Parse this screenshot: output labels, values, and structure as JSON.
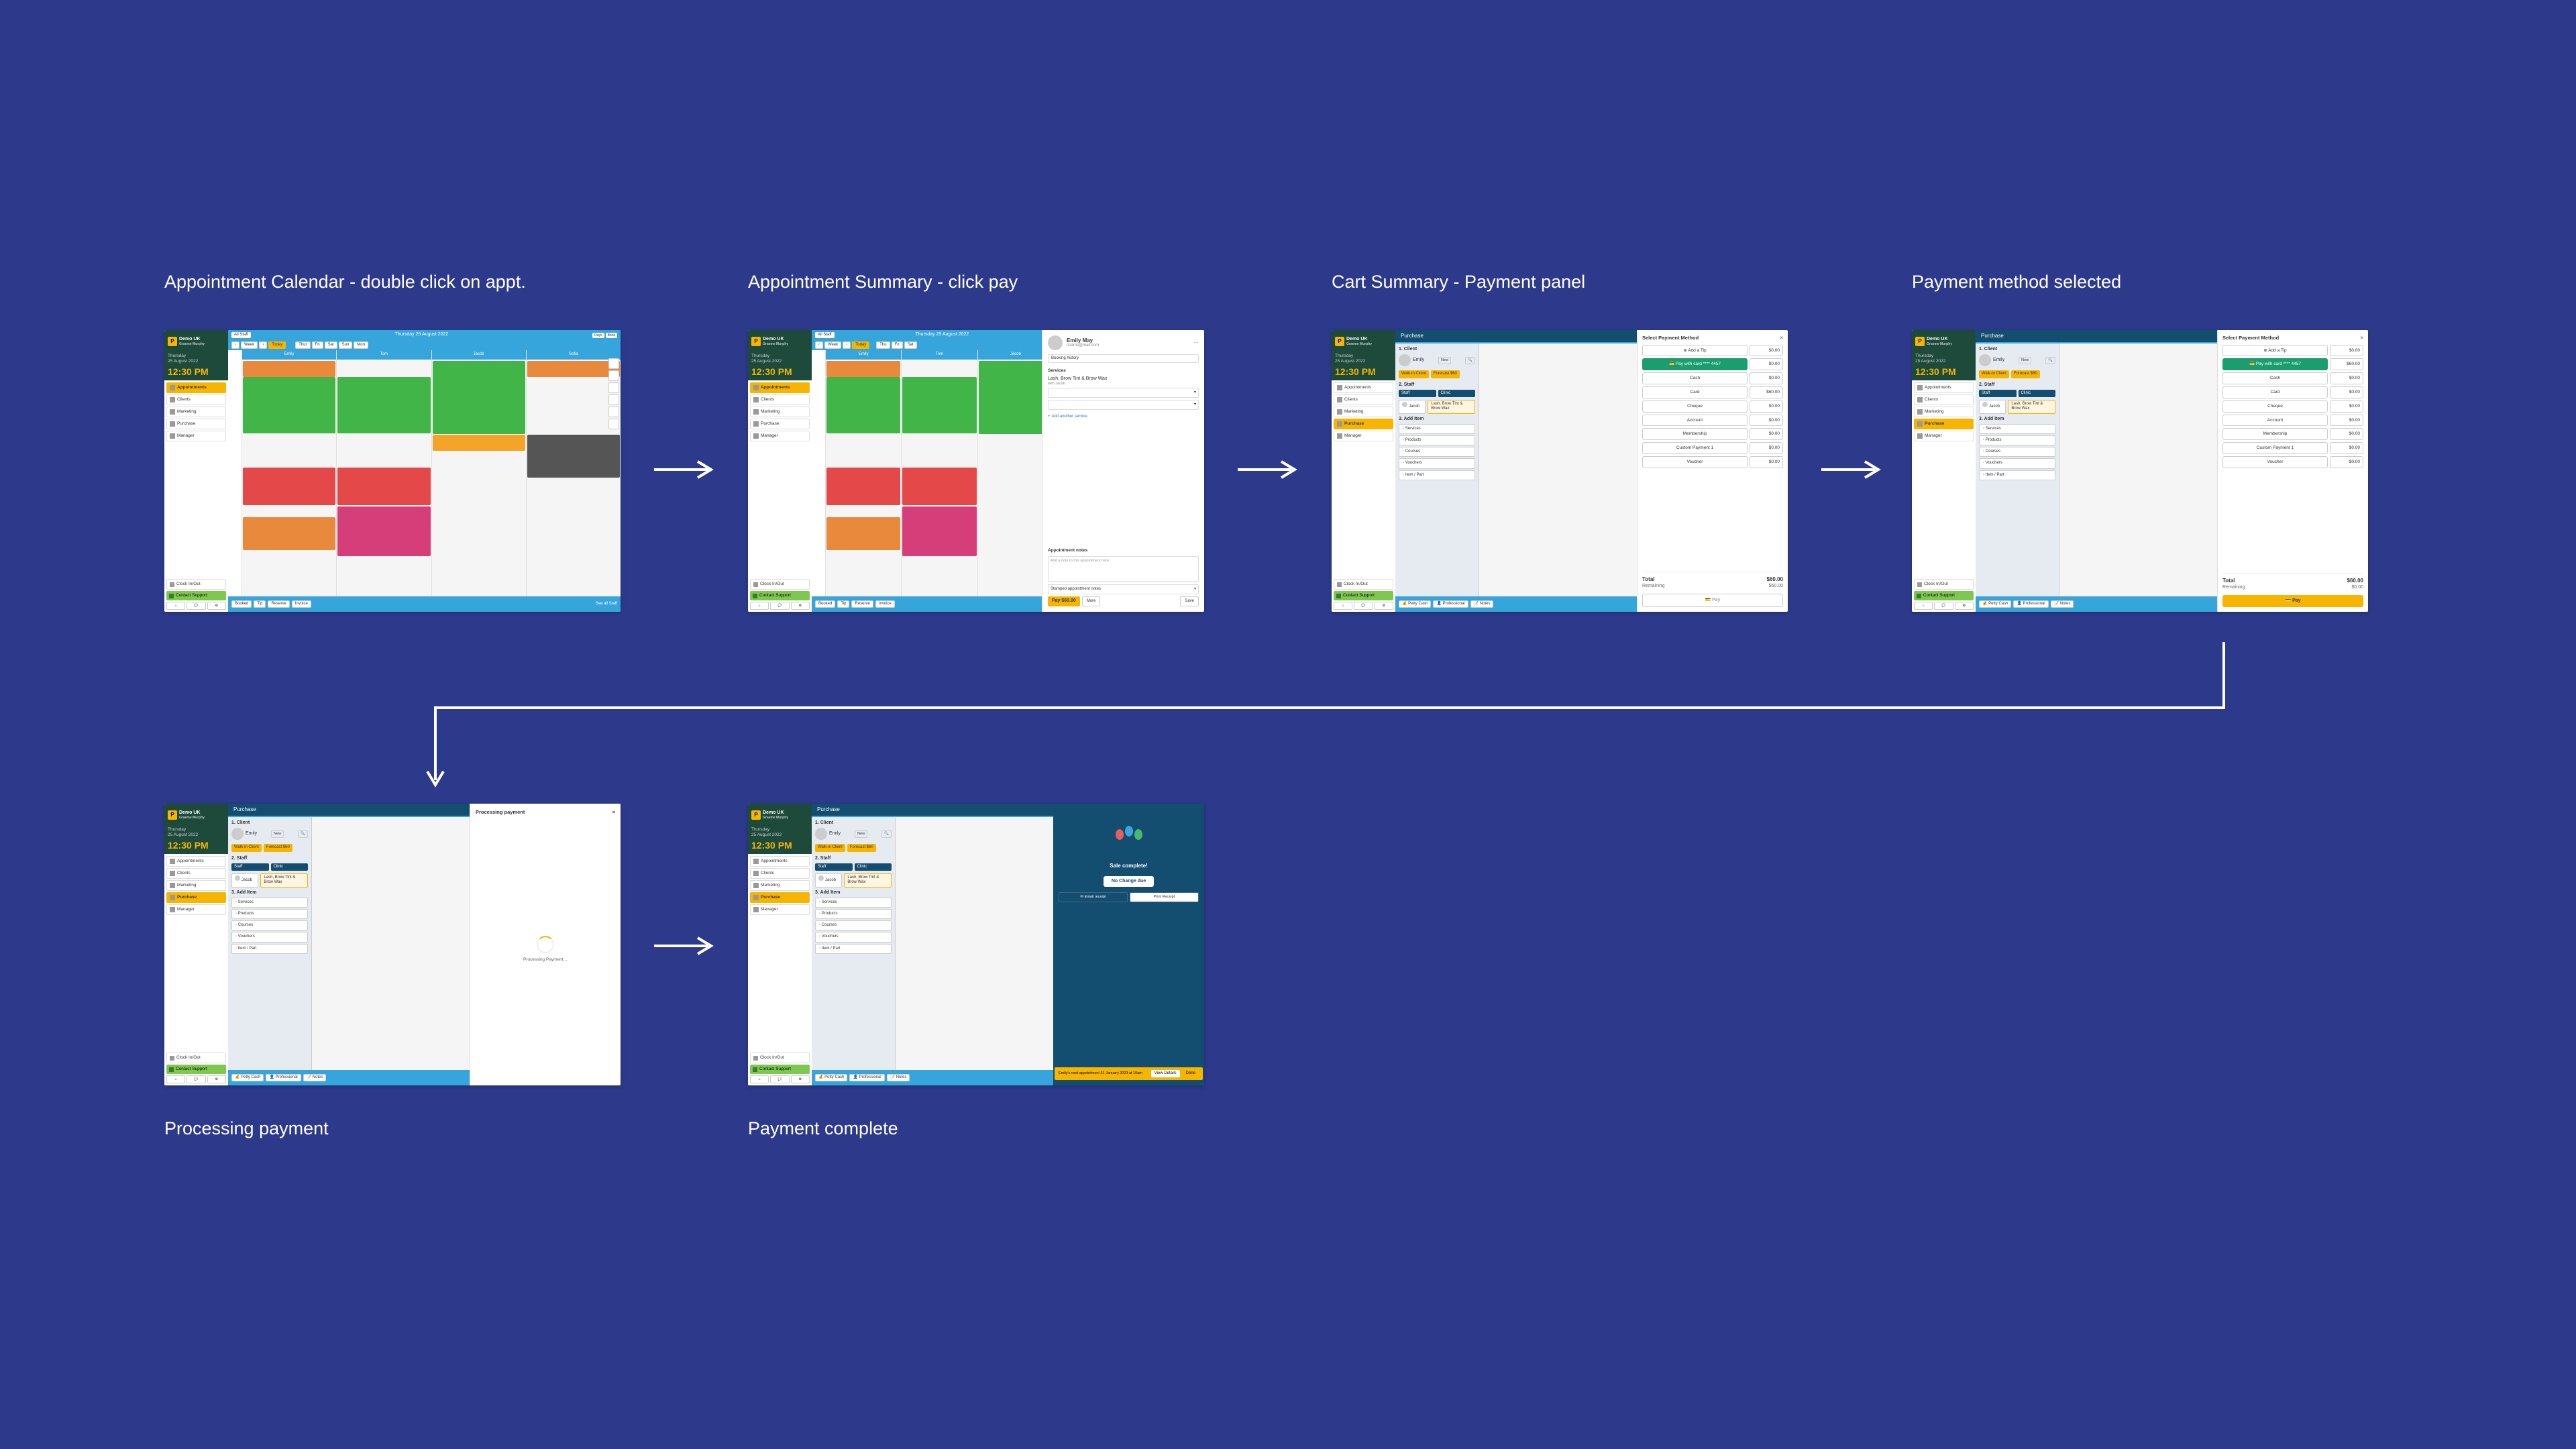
{
  "labels": {
    "s1": "Appointment Calendar - double click on appt.",
    "s2": "Appointment Summary - click pay",
    "s3": "Cart Summary - Payment panel",
    "s4": "Payment method selected",
    "s5": "Processing payment",
    "s6": "Payment complete"
  },
  "sidebar": {
    "brand": "Demo UK",
    "brand_sub": "Graeme Murphy",
    "date_label": "Thursday",
    "date_sub": "25 August 2022",
    "time": "12:30 PM",
    "nav": {
      "appts": "Appointments",
      "clients": "Clients",
      "marketing": "Marketing",
      "purchase": "Purchase",
      "manager": "Manager"
    },
    "clock": "Clock In/Out",
    "support": "Contact Support"
  },
  "calendar": {
    "staffbtn": "All Staff",
    "date": "Thursday 25 August 2022",
    "view_days": "Days",
    "view_book": "Book",
    "nav_week": "Week",
    "nav_today": "Today",
    "col1": "Emily",
    "col2": "Tom",
    "col3": "Jacob",
    "col4": "Sofia",
    "bottom_tags": [
      "Booked",
      "Tip",
      "Reserve",
      "Invoice"
    ],
    "see_all": "See all Staff"
  },
  "appt_panel": {
    "name": "Emily May",
    "email": "charris@mail.com",
    "booking_history": "Booking history",
    "services_hdr": "Services",
    "svc": "Lash, Brow Tint & Brow Wax",
    "svc_sub": "with Jacob",
    "select_placeholder": "",
    "add_another": "Add another service",
    "notes_hdr": "Appointment notes",
    "notes_placeholder": "Add a note to this appointment here",
    "stamp": "Stamped appointment notes",
    "pay_btn": "Pay $60.00",
    "more": "More",
    "save": "Save"
  },
  "purchase": {
    "title": "Purchase",
    "client_hdr": "1. Client",
    "client_name": "Emily",
    "new": "New",
    "q_search": "Q",
    "walkin": "Walk-in Client",
    "forecast": "Forecast $60",
    "staff_hdr": "2. Staff",
    "staff_col1": "Staff",
    "staff_col2": "Clinic",
    "staff_sel": "Jacob",
    "add_hdr": "3. Add Item",
    "opts": {
      "services": "Services",
      "products": "Products",
      "courses": "Courses",
      "vouchers": "Vouchers",
      "item": "Item / Part"
    },
    "cart_item": "Lash, Brow Tint & Brow Wax",
    "bottom": [
      "Petty Cash",
      "Professional",
      "Notes"
    ]
  },
  "payment": {
    "hdr": "Select Payment Method",
    "tip": "Add a Tip",
    "card": "Pay with card **** 4457",
    "cash": "Cash",
    "card2": "Card",
    "cheque": "Cheque",
    "account": "Account",
    "membership": "Membership",
    "custom": "Custom Payment 1",
    "voucher": "Voucher",
    "amt": "$0.00",
    "amt_total": "$60.00",
    "total_lbl": "Total",
    "total": "$60.00",
    "remaining_lbl": "Remaining",
    "remaining": "$60.00",
    "remaining_zero": "$0.00",
    "pay": "Pay"
  },
  "processing": {
    "hdr": "Processing payment",
    "text": "Processing Payment…"
  },
  "complete": {
    "msg": "Sale complete!",
    "change": "No Change due",
    "email": "Email receipt",
    "print": "Print Receipt",
    "banner_txt": "Emily's next appointment 31 January 2023 at 10am",
    "banner_btn": "View Details",
    "banner_done": "Done"
  }
}
